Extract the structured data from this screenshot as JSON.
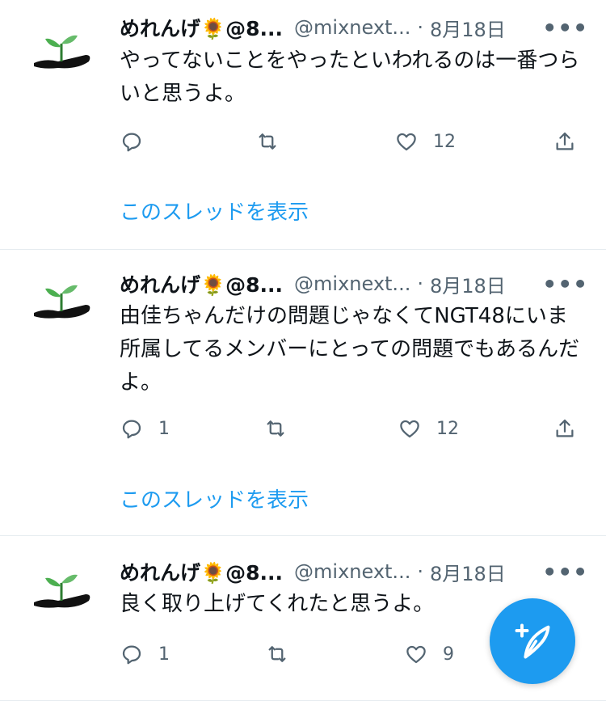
{
  "tweets": [
    {
      "name": "めれんげ🌻@8...",
      "handle": "@mixnext...",
      "separator": "·",
      "date": "8月18日",
      "text": "やってないことをやったといわれるのは一番つらいと思うよ。",
      "replies": "",
      "likes": "12",
      "show_thread": "このスレッドを表示"
    },
    {
      "name": "めれんげ🌻@8...",
      "handle": "@mixnext...",
      "separator": "·",
      "date": "8月18日",
      "text": "由佳ちゃんだけの問題じゃなくてNGT48にいま所属してるメンバーにとっての問題でもあるんだよ。",
      "replies": "1",
      "likes": "12",
      "show_thread": "このスレッドを表示"
    },
    {
      "name": "めれんげ🌻@8...",
      "handle": "@mixnext...",
      "separator": "·",
      "date": "8月18日",
      "text": "良く取り上げてくれたと思うよ。",
      "replies": "1",
      "likes": "9",
      "show_thread": ""
    }
  ],
  "icons": {
    "reply": "reply-bubble-icon",
    "retweet": "retweet-arrows-icon",
    "like": "heart-icon",
    "share": "share-upload-icon",
    "more": "more-dots-icon",
    "compose": "compose-feather-icon",
    "avatar": "sprout-on-spoon-avatar"
  },
  "colors": {
    "accent": "#1d9bf0",
    "secondary_text": "#536471",
    "primary_text": "#0f1419",
    "divider": "#e6ecf0"
  }
}
